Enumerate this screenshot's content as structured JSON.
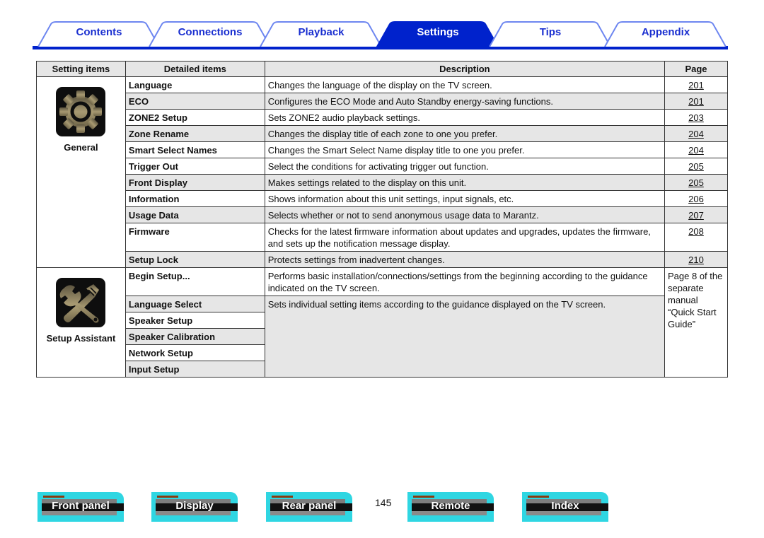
{
  "tabs": [
    {
      "label": "Contents",
      "active": false
    },
    {
      "label": "Connections",
      "active": false
    },
    {
      "label": "Playback",
      "active": false
    },
    {
      "label": "Settings",
      "active": true
    },
    {
      "label": "Tips",
      "active": false
    },
    {
      "label": "Appendix",
      "active": false
    }
  ],
  "colors": {
    "accent": "#0022cc",
    "tab_text": "#1a2fd0",
    "nav_button": "#2fd6e2",
    "row_shade": "#e6e6e6"
  },
  "table": {
    "headers": [
      "Setting items",
      "Detailed items",
      "Description",
      "Page"
    ],
    "groups": [
      {
        "category": "General",
        "icon": "gear-icon",
        "rows": [
          {
            "item": "Language",
            "description": "Changes the language of the display on the TV screen.",
            "page": "201"
          },
          {
            "item": "ECO",
            "description": "Configures the ECO Mode and Auto Standby energy-saving functions.",
            "page": "201"
          },
          {
            "item": "ZONE2 Setup",
            "description": "Sets ZONE2 audio playback settings.",
            "page": "203"
          },
          {
            "item": "Zone Rename",
            "description": "Changes the display title of each zone to one you prefer.",
            "page": "204"
          },
          {
            "item": "Smart Select Names",
            "description": "Changes the Smart Select Name display title to one you prefer.",
            "page": "204"
          },
          {
            "item": "Trigger Out",
            "description": "Select the conditions for activating trigger out function.",
            "page": "205"
          },
          {
            "item": "Front Display",
            "description": "Makes settings related to the display on this unit.",
            "page": "205"
          },
          {
            "item": "Information",
            "description": "Shows information about this unit settings, input signals, etc.",
            "page": "206"
          },
          {
            "item": "Usage Data",
            "description": "Selects whether or not to send anonymous usage data to Marantz.",
            "page": "207"
          },
          {
            "item": "Firmware",
            "description": "Checks for the latest firmware information about updates and upgrades, updates the firmware, and sets up the notification message display.",
            "page": "208"
          },
          {
            "item": "Setup Lock",
            "description": "Protects settings from inadvertent changes.",
            "page": "210"
          }
        ]
      },
      {
        "category": "Setup Assistant",
        "icon": "tools-icon",
        "page_note": "Page 8 of the separate manual “Quick Start Guide”",
        "rows": [
          {
            "item": "Begin Setup...",
            "description": "Performs basic installation/connections/settings from the beginning according to the guidance indicated on the TV screen."
          },
          {
            "item": "Language Select",
            "description": "Sets individual setting items according to the guidance displayed on the TV screen."
          },
          {
            "item": "Speaker Setup"
          },
          {
            "item": "Speaker Calibration"
          },
          {
            "item": "Network Setup"
          },
          {
            "item": "Input Setup"
          }
        ]
      }
    ]
  },
  "footer": {
    "buttons": [
      "Front panel",
      "Display",
      "Rear panel",
      "Remote",
      "Index"
    ],
    "page_number": "145"
  }
}
